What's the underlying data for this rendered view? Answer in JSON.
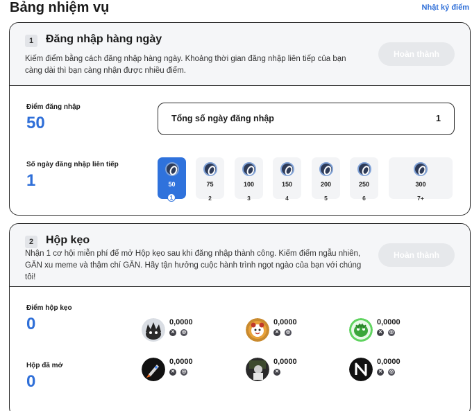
{
  "header": {
    "title": "Bảng nhiệm vụ",
    "log_link": "Nhật ký điểm"
  },
  "task1": {
    "num": "1",
    "title": "Đăng nhập hàng ngày",
    "desc": "Kiếm điểm bằng cách đăng nhập hàng ngày. Khoảng thời gian đăng nhập liên tiếp của bạn càng dài thì bạn càng nhận được nhiều điểm.",
    "button": "Hoàn thành",
    "points_label": "Điểm đăng nhập",
    "points_value": "50",
    "streak_label": "Số ngày đăng nhập liên tiếp",
    "streak_value": "1",
    "total_label": "Tổng số ngày đăng nhập",
    "total_value": "1",
    "days": [
      {
        "points": "50",
        "day": "1"
      },
      {
        "points": "75",
        "day": "2"
      },
      {
        "points": "100",
        "day": "3"
      },
      {
        "points": "150",
        "day": "4"
      },
      {
        "points": "200",
        "day": "5"
      },
      {
        "points": "250",
        "day": "6"
      },
      {
        "points": "300",
        "day": "7+"
      }
    ]
  },
  "task2": {
    "num": "2",
    "title": "Hộp kẹo",
    "desc": "Nhận 1 cơ hội miễn phí để mở Hộp kẹo sau khi đăng nhập thành công. Kiếm điểm ngẫu nhiên, GĂN xu meme và thậm chí GĂN. Hãy tận hưởng cuộc hành trình ngọt ngào của bạn với chúng tôi!",
    "button": "Hoàn thành",
    "points_label": "Điểm hộp kẹo",
    "points_value": "0",
    "opened_label": "Hộp đã mở",
    "opened_value": "0",
    "rewards": [
      {
        "value": "0,0000",
        "icon": "spiky-creature-icon"
      },
      {
        "value": "0,0000",
        "icon": "panda-icon"
      },
      {
        "value": "0,0000",
        "icon": "green-dragon-icon"
      },
      {
        "value": "0,0000",
        "icon": "rocket-icon"
      },
      {
        "value": "0,0000",
        "icon": "character-photo-icon"
      },
      {
        "value": "0,0000",
        "icon": "near-logo-icon"
      }
    ]
  }
}
